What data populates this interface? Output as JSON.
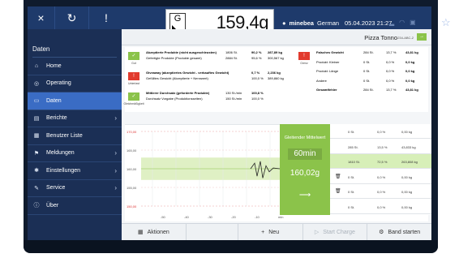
{
  "topbar": {
    "close_icon": "×",
    "reload_icon": "↻",
    "info_icon": "!",
    "weight_mark": "G",
    "weight": "159,4",
    "weight_unit": "g",
    "user_icon": "person-icon",
    "user_brand": "minebea",
    "user_lang": "German",
    "datetime": "05.04.2023 21:27",
    "star_icon": "☆"
  },
  "sidebar": {
    "title": "Daten",
    "items": [
      {
        "label": "Home",
        "icon": "⌂",
        "chevron": ""
      },
      {
        "label": "Operating",
        "icon": "◎",
        "chevron": ""
      },
      {
        "label": "Daten",
        "icon": "▭",
        "chevron": ""
      },
      {
        "label": "Berichte",
        "icon": "▤",
        "chevron": "›"
      },
      {
        "label": "Benutzer Liste",
        "icon": "▦",
        "chevron": ""
      },
      {
        "label": "Meldungen",
        "icon": "⚑",
        "chevron": "›"
      },
      {
        "label": "Einstellungen",
        "icon": "✱",
        "chevron": "›"
      },
      {
        "label": "Service",
        "icon": "✎",
        "chevron": "›"
      },
      {
        "label": "Über",
        "icon": "ⓘ",
        "chevron": ""
      }
    ]
  },
  "product": {
    "name": "Pizza Tonno",
    "code": "1234-ABC-2",
    "action": "→"
  },
  "stats_left": [
    {
      "flag": "✓",
      "flag_label": "Gut",
      "title": "Akzeptierte Produkte (nicht ausgeschleusten)",
      "sub": "Gefertigte Produkte (Produkte gesamt)",
      "v1": "1806 St.",
      "v2": "2884 St.",
      "p1": "90,2 %",
      "p2": "95,6 %",
      "w1": "287,89 kg",
      "w2": "300,567 kg"
    },
    {
      "flag": "!",
      "flag_label": "Unterlast",
      "title": "Giveaway (akzeptiertes Gewicht - verkauftes Gewicht)",
      "sub": "Gefülltes Gewicht (Akzeptierte + Nennwert)",
      "v1": "",
      "v2": "",
      "p1": "0,7 %",
      "p2": "100,0 %",
      "w1": "2,236 kg",
      "w2": "389,860 kg"
    },
    {
      "flag": "✓",
      "flag_label": "Gleichmäßigkeit",
      "title": "Mittlerer Durchsatz (geforderte Produkte)",
      "sub": "Durchsatz Vorgabe (Produktionsseiten)",
      "v1": "130 St./min",
      "v2": "150 St./min",
      "p1": "100,8 %",
      "p2": "100,0 %",
      "w1": "",
      "w2": ""
    }
  ],
  "stats_right": {
    "flag": "!",
    "flag_label": "Grenz",
    "rows": [
      {
        "label": "Falsches Gewicht",
        "v": "284 St.",
        "p": "13,7 %",
        "w": "43,81 kg"
      },
      {
        "label": "Produkt: Kleiner",
        "v": "0 St.",
        "p": "0,0 %",
        "w": "0,0 kg"
      },
      {
        "label": "Produkt: Länge",
        "v": "0 St.",
        "p": "0,0 %",
        "w": "0,0 kg"
      },
      {
        "label": "Andere",
        "v": "0 St.",
        "p": "0,0 %",
        "w": "0,0 kg"
      },
      {
        "label": "Gesamtfehler",
        "v": "284 St.",
        "p": "13,7 %",
        "w": "43,81 kg"
      }
    ]
  },
  "chart_data": {
    "type": "line",
    "y_ticks": [
      "170,00",
      "165,00",
      "160,00",
      "155,00",
      "150,00"
    ],
    "x_ticks": [
      "-50",
      "-40",
      "-30",
      "-20",
      "-10",
      "min"
    ],
    "target_band": [
      157,
      163
    ],
    "callout": {
      "title": "Gleitender Mittelwert",
      "time": "60min",
      "value": "160,02g"
    }
  },
  "right_table": [
    {
      "icon": "",
      "count": "0 St.",
      "pct": "0,0 %",
      "kg": "0,00 kg"
    },
    {
      "icon": "",
      "count": "285 St.",
      "pct": "13,5 %",
      "kg": "43,833 kg"
    },
    {
      "icon": "",
      "count": "1810 St.",
      "pct": "72,5 %",
      "kg": "263,808 kg"
    },
    {
      "icon": "trash-icon",
      "count": "0 St.",
      "pct": "0,0 %",
      "kg": "0,00 kg"
    },
    {
      "icon": "trash-icon",
      "count": "0 St.",
      "pct": "0,0 %",
      "kg": "0,00 kg"
    },
    {
      "icon": "",
      "count": "0 St.",
      "pct": "0,0 %",
      "kg": "0,00 kg"
    }
  ],
  "bottombar": {
    "actions_icon": "▦",
    "actions": "Aktionen",
    "new_icon": "+",
    "new": "Neu",
    "start_charge_icon": "▷",
    "start_charge": "Start Charge",
    "start_band_icon": "⚙",
    "start_band": "Band starten"
  },
  "colors": {
    "navy": "#1b2f55",
    "active": "#3a6cc4",
    "green": "#8bc34a",
    "red": "#e23b2e"
  }
}
